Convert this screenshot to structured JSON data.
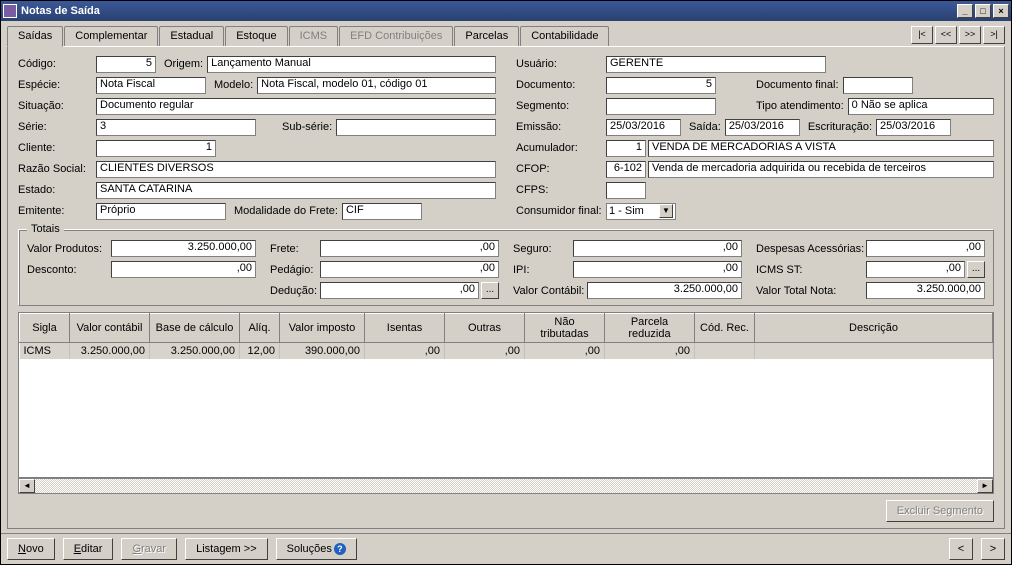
{
  "window": {
    "title": "Notas de Saída"
  },
  "tabs": {
    "saidas": "Saídas",
    "complementar": "Complementar",
    "estadual": "Estadual",
    "estoque": "Estoque",
    "icms": "ICMS",
    "efd": "EFD Contribuições",
    "parcelas": "Parcelas",
    "contabilidade": "Contabilidade"
  },
  "nav": {
    "first": "|<",
    "prev": "<<",
    "next": ">>",
    "last": ">|"
  },
  "labels": {
    "codigo": "Código:",
    "origem": "Origem:",
    "especie": "Espécie:",
    "modelo": "Modelo:",
    "situacao": "Situação:",
    "serie": "Série:",
    "subserie": "Sub-série:",
    "cliente": "Cliente:",
    "razao": "Razão Social:",
    "estado": "Estado:",
    "emitente": "Emitente:",
    "modfrete": "Modalidade do Frete:",
    "usuario": "Usuário:",
    "documento": "Documento:",
    "docfinal": "Documento final:",
    "segmento": "Segmento:",
    "tipoatend": "Tipo atendimento:",
    "emissao": "Emissão:",
    "saida": "Saída:",
    "escrit": "Escrituração:",
    "acumulador": "Acumulador:",
    "cfop": "CFOP:",
    "cfps": "CFPS:",
    "consfinal": "Consumidor final:"
  },
  "values": {
    "codigo": "5",
    "origem": "Lançamento Manual",
    "especie": "Nota Fiscal",
    "modelo": "Nota Fiscal, modelo 01, código 01",
    "situacao": "Documento regular",
    "serie": "3",
    "subserie": "",
    "cliente": "1",
    "razao": "CLIENTES DIVERSOS",
    "estado": "SANTA CATARINA",
    "emitente": "Próprio",
    "modfrete": "CIF",
    "usuario": "GERENTE",
    "documento": "5",
    "docfinal": "",
    "segmento": "",
    "tipoatend": "0 Não se aplica",
    "emissao": "25/03/2016",
    "saida": "25/03/2016",
    "escrit": "25/03/2016",
    "acumulador_cod": "1",
    "acumulador_desc": "VENDA DE MERCADORIAS A VISTA",
    "cfop_cod": "6-102",
    "cfop_desc": "Venda de mercadoria adquirida ou recebida de terceiros",
    "cfps": "",
    "consfinal": "1 - Sim"
  },
  "totais": {
    "legend": "Totais",
    "labels": {
      "vprod": "Valor Produtos:",
      "frete": "Frete:",
      "seguro": "Seguro:",
      "despesas": "Despesas Acessórias:",
      "desconto": "Desconto:",
      "pedagio": "Pedágio:",
      "ipi": "IPI:",
      "icmsst": "ICMS ST:",
      "deducao": "Dedução:",
      "vcontabil": "Valor Contábil:",
      "vtotal": "Valor Total Nota:"
    },
    "values": {
      "vprod": "3.250.000,00",
      "frete": ",00",
      "seguro": ",00",
      "despesas": ",00",
      "desconto": ",00",
      "pedagio": ",00",
      "ipi": ",00",
      "icmsst": ",00",
      "deducao": ",00",
      "vcontabil": "3.250.000,00",
      "vtotal": "3.250.000,00"
    }
  },
  "grid": {
    "headers": {
      "sigla": "Sigla",
      "vcontabil": "Valor contábil",
      "base": "Base de cálculo",
      "aliq": "Alíq.",
      "vimposto": "Valor imposto",
      "isentas": "Isentas",
      "outras": "Outras",
      "naotrib": "Não tributadas",
      "parcred": "Parcela reduzida",
      "codrec": "Cód. Rec.",
      "descr": "Descrição"
    },
    "row": {
      "sigla": "ICMS",
      "vcontabil": "3.250.000,00",
      "base": "3.250.000,00",
      "aliq": "12,00",
      "vimposto": "390.000,00",
      "isentas": ",00",
      "outras": ",00",
      "naotrib": ",00",
      "parcred": ",00",
      "codrec": "",
      "descr": ""
    }
  },
  "buttons": {
    "excluir_seg": "Excluir Segmento",
    "novo": "Novo",
    "editar": "Editar",
    "gravar": "Gravar",
    "listagem": "Listagem >>",
    "solucoes": "Soluções",
    "prev_page": "<",
    "next_page": ">",
    "dots": "..."
  }
}
